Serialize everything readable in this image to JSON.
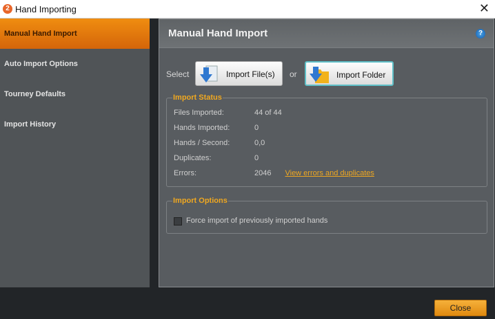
{
  "window": {
    "title": "Hand Importing",
    "icon_text": "2"
  },
  "sidebar": {
    "items": [
      {
        "label": "Manual Hand Import"
      },
      {
        "label": "Auto Import Options"
      },
      {
        "label": "Tourney Defaults"
      },
      {
        "label": "Import History"
      }
    ]
  },
  "main": {
    "title": "Manual Hand Import",
    "help": "?",
    "select_label": "Select",
    "or_label": "or",
    "import_files_label": "Import File(s)",
    "import_folder_label": "Import Folder",
    "status": {
      "legend": "Import Status",
      "rows": [
        {
          "label": "Files Imported:",
          "value": "44 of 44"
        },
        {
          "label": "Hands Imported:",
          "value": "0"
        },
        {
          "label": "Hands / Second:",
          "value": "0,0"
        },
        {
          "label": "Duplicates:",
          "value": "0"
        },
        {
          "label": "Errors:",
          "value": "2046"
        }
      ],
      "errors_link": "View errors and duplicates"
    },
    "options": {
      "legend": "Import Options",
      "force_label": "Force import of previously imported hands",
      "force_checked": false
    }
  },
  "footer": {
    "close_label": "Close"
  }
}
